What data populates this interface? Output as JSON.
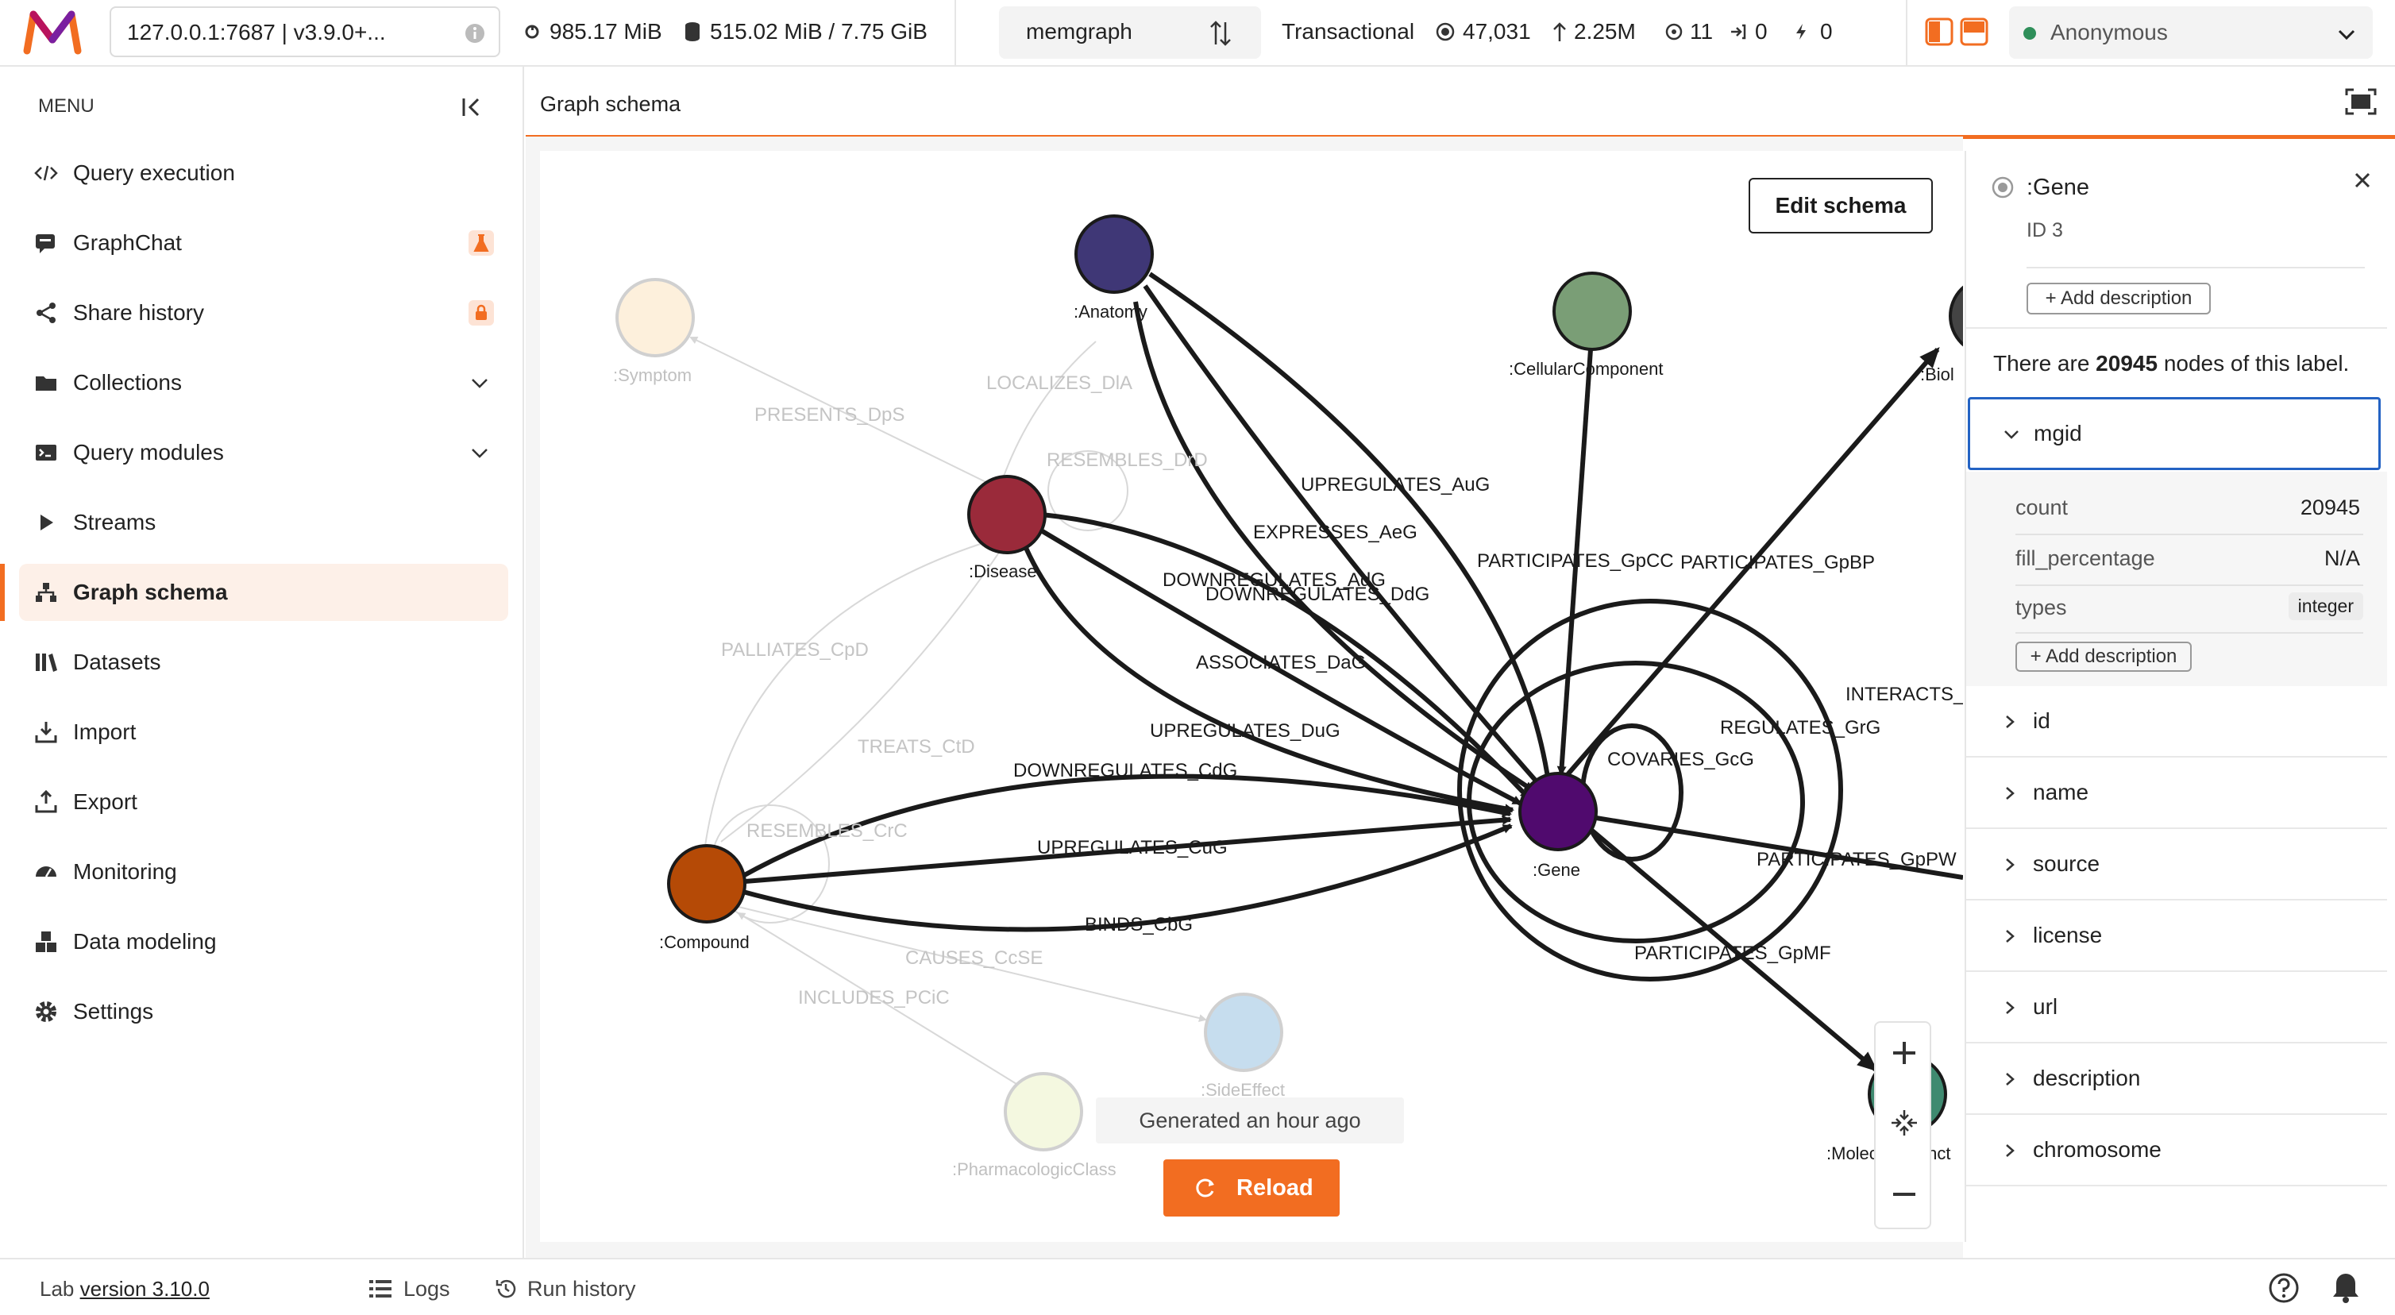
{
  "topbar": {
    "connection": "127.0.0.1:7687 | v3.9.0+...",
    "memory": "985.17 MiB",
    "disk": "515.02 MiB / 7.75 GiB",
    "database": "memgraph",
    "storage_mode": "Transactional",
    "nodes": "47,031",
    "edges": "2.25M",
    "stat_3": "11",
    "stat_4": "0",
    "stat_5": "0",
    "user": "Anonymous"
  },
  "sidebar": {
    "menu_label": "MENU",
    "items": [
      {
        "label": "Query execution",
        "icon": "code-icon"
      },
      {
        "label": "GraphChat",
        "icon": "chat-icon",
        "badge": "flask-icon"
      },
      {
        "label": "Share history",
        "icon": "share-icon",
        "badge": "lock-icon"
      },
      {
        "label": "Collections",
        "icon": "folder-icon"
      },
      {
        "label": "Query modules",
        "icon": "module-icon"
      },
      {
        "label": "Streams",
        "icon": "play-icon"
      },
      {
        "label": "Graph schema",
        "icon": "schema-icon"
      },
      {
        "label": "Datasets",
        "icon": "library-icon"
      },
      {
        "label": "Import",
        "icon": "import-icon"
      },
      {
        "label": "Export",
        "icon": "export-icon"
      },
      {
        "label": "Monitoring",
        "icon": "monitoring-icon"
      },
      {
        "label": "Data modeling",
        "icon": "cubes-icon"
      },
      {
        "label": "Settings",
        "icon": "gear-icon"
      }
    ]
  },
  "header": {
    "title": "Graph schema"
  },
  "canvas": {
    "edit_schema": "Edit schema",
    "generated": "Generated an hour ago",
    "reload": "Reload",
    "nodes": {
      "symptom": ":Symptom",
      "anatomy": ":Anatomy",
      "cellular": ":CellularComponent",
      "biol": ":Biol",
      "disease": ":Disease",
      "compound": ":Compound",
      "gene": ":Gene",
      "sideeffect": ":SideEffect",
      "pharma": ":PharmacologicClass",
      "molecular": ":MolecularFunct"
    },
    "edges": {
      "presents": "PRESENTS_DpS",
      "localizes": "LOCALIZES_DlA",
      "resembles_d": "RESEMBLES_DrD",
      "upreg_aug": "UPREGULATES_AuG",
      "expresses": "EXPRESSES_AeG",
      "downreg_adg": "DOWNREGULATES_AdG",
      "downreg_ddg": "DOWNREGULATES_DdG",
      "participates_gpcc": "PARTICIPATES_GpCC",
      "participates_gpbp": "PARTICIPATES_GpBP",
      "associates": "ASSOCIATES_DaG",
      "palliates": "PALLIATES_CpD",
      "interacts": "INTERACTS_",
      "regulates": "REGULATES_GrG",
      "treats": "TREATS_CtD",
      "upreg_dug": "UPREGULATES_DuG",
      "covaries": "COVARIES_GcG",
      "downreg_cdg": "DOWNREGULATES_CdG",
      "resembles_c": "RESEMBLES_CrC",
      "upreg_cug": "UPREGULATES_CuG",
      "participates_gppw": "PARTICIPATES_GpPW",
      "binds": "BINDS_CbG",
      "causes": "CAUSES_CcSE",
      "participates_gpmf": "PARTICIPATES_GpMF",
      "includes": "INCLUDES_PCiC"
    },
    "colors": {
      "anatomy": "#3f3776",
      "cellular": "#7a9e76",
      "disease": "#9a2a3a",
      "compound": "#b54a06",
      "gene": "#500a6e",
      "molecular": "#3f8a70",
      "symptom": "#fdf0dc",
      "sideeffect": "#c6ddee",
      "pharma": "#f4f8e0",
      "accent": "#f26d21"
    }
  },
  "panel": {
    "label": ":Gene",
    "id": "ID 3",
    "add_description": "+ Add description",
    "count_prefix": "There are ",
    "count_value": "20945",
    "count_suffix": " nodes of this label.",
    "expanded": {
      "name": "mgid",
      "rows": [
        {
          "k": "count",
          "v": "20945"
        },
        {
          "k": "fill_percentage",
          "v": "N/A"
        },
        {
          "k": "types",
          "v": "integer"
        }
      ],
      "add_description": "+ Add description"
    },
    "properties": [
      "id",
      "name",
      "source",
      "license",
      "url",
      "description",
      "chromosome"
    ]
  },
  "bottombar": {
    "lab_prefix": "Lab ",
    "version": "version 3.10.0",
    "logs": "Logs",
    "run_history": "Run history"
  }
}
